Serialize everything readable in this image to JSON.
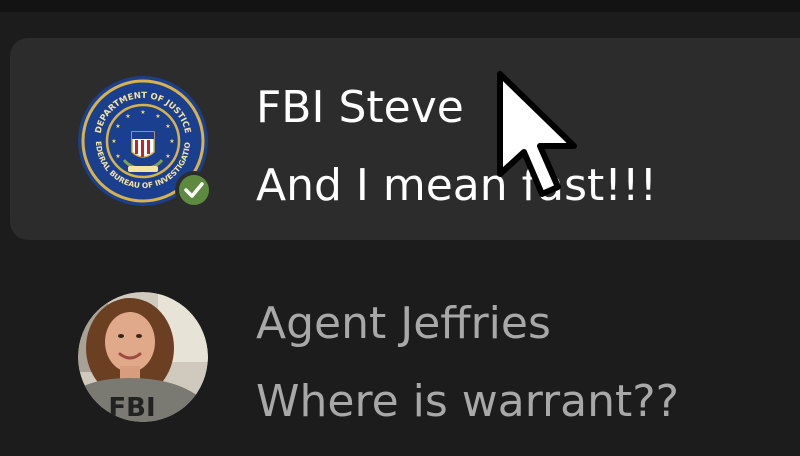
{
  "chats": [
    {
      "name": "FBI Steve",
      "message": "And I mean fast!!!",
      "avatar_icon": "fbi-seal-icon",
      "verified": true,
      "seal_text_top": "DEPARTMENT OF JUSTICE",
      "seal_text_bottom": "FEDERAL BUREAU OF INVESTIGATION"
    },
    {
      "name": "Agent Jeffries",
      "message": "Where is warrant??",
      "avatar_icon": "profile-photo",
      "shirt_text": "FBI"
    }
  ],
  "colors": {
    "background": "#1c1c1c",
    "active_row": "#2c2c2c",
    "verified_green": "#5e8a3f",
    "seal_blue": "#1b3f8f",
    "seal_gold": "#d8b24a"
  }
}
